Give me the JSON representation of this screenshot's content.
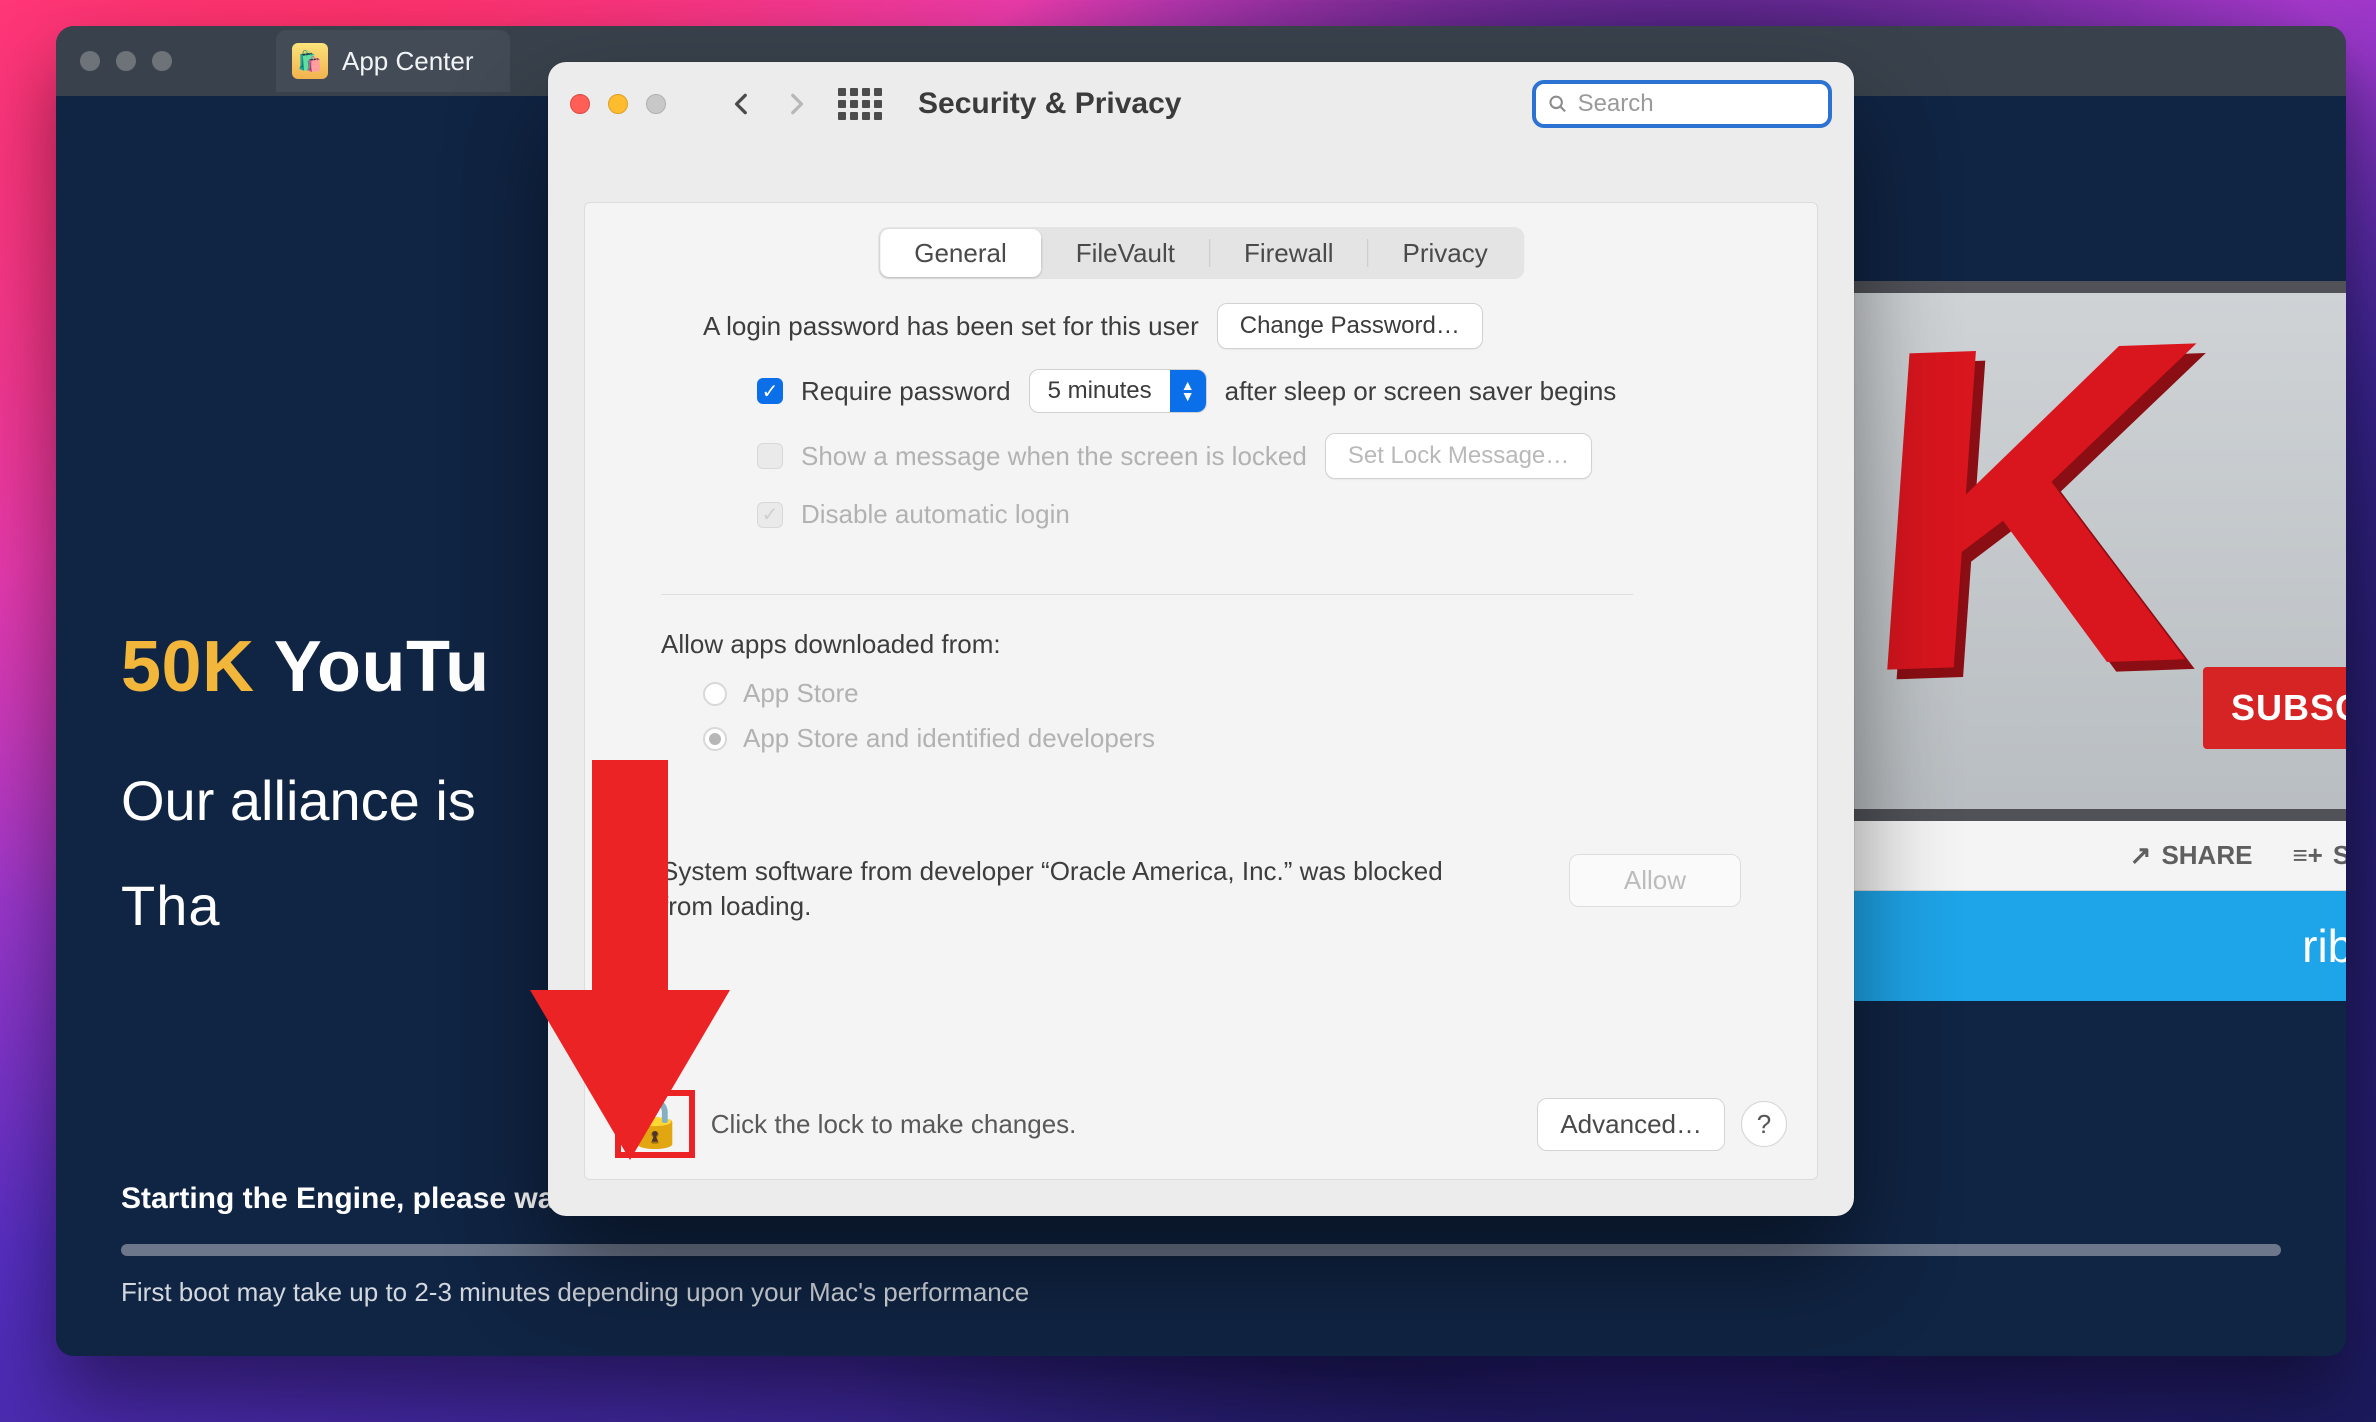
{
  "bg_window": {
    "tab_label": "App Center",
    "headline_gold": "50K",
    "headline_rest": " YouTu",
    "sub1": "Our alliance is",
    "sub2": "Tha",
    "status1": "Starting the Engine, please wait",
    "status2": "First boot may take up to 2-3 minutes depending upon your Mac's performance"
  },
  "yt": {
    "subscribe": "SUBSCRIBE",
    "share": "SHARE",
    "save": "SAVE",
    "subnow": "ribe now"
  },
  "prefs": {
    "title": "Security & Privacy",
    "search_placeholder": "Search",
    "tabs": {
      "general": "General",
      "filevault": "FileVault",
      "firewall": "Firewall",
      "privacy": "Privacy"
    },
    "login_pw_set": "A login password has been set for this user",
    "change_password": "Change Password…",
    "require_password": "Require password",
    "delay_value": "5 minutes",
    "after_sleep": "after sleep or screen saver begins",
    "show_message": "Show a message when the screen is locked",
    "set_lock_message": "Set Lock Message…",
    "disable_autologin": "Disable automatic login",
    "allow_apps_title": "Allow apps downloaded from:",
    "opt_appstore": "App Store",
    "opt_identified": "App Store and identified developers",
    "blocked_text": "System software from developer “Oracle America, Inc.” was blocked from loading.",
    "allow_btn": "Allow",
    "lock_text": "Click the lock to make changes.",
    "advanced": "Advanced…",
    "help": "?"
  }
}
